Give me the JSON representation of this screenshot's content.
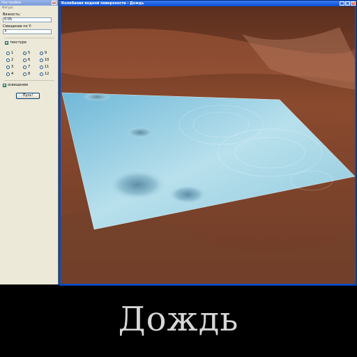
{
  "settings": {
    "title": "Настройки",
    "menu": "Фигура",
    "close_icon": "close-icon",
    "viscosity_label": "Вязкость:",
    "viscosity_value": "0.05",
    "offset_label": "Смещение по Y:",
    "offset_value": "3",
    "texture_label": "текстура",
    "texture_checked": true,
    "radio_options": [
      "1",
      "2",
      "3",
      "4",
      "5",
      "6",
      "7",
      "8",
      "9",
      "10",
      "11",
      "12"
    ],
    "radio_selected": "5",
    "lighting_label": "освещение",
    "lighting_checked": true,
    "go_button": "Пуск!"
  },
  "main_window": {
    "title": "Колебания водной поверхности - Дождь",
    "buttons": [
      "minimize-icon",
      "maximize-icon",
      "close-icon"
    ]
  },
  "caption": "Дождь",
  "colors": {
    "window_frame": "#0050c8",
    "panel_bg": "#ece9d8",
    "water": "#9fd0e0",
    "terrain": "#8a4a2e",
    "caption_text": "#d6d6d6"
  }
}
